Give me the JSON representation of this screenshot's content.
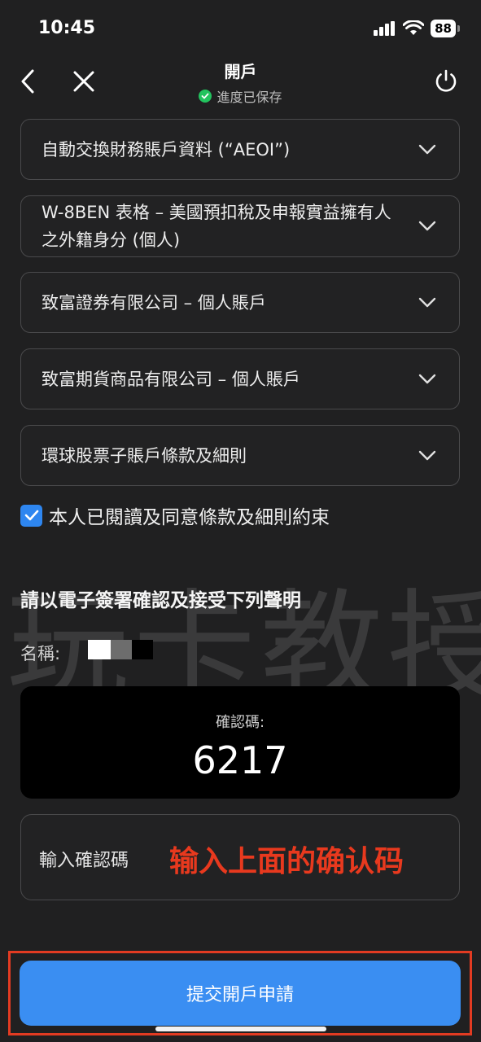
{
  "status_bar": {
    "time": "10:45",
    "battery": "88"
  },
  "nav": {
    "title": "開戶",
    "subtitle": "進度已保存"
  },
  "sections": [
    {
      "label": "自動交換財務賬戶資料 (“AEOI”)"
    },
    {
      "label": "W-8BEN 表格 – 美國預扣稅及申報實益擁有人之外籍身分 (個人)"
    },
    {
      "label": "致富證券有限公司 – 個人賬戶"
    },
    {
      "label": "致富期貨商品有限公司 – 個人賬戶"
    },
    {
      "label": "環球股票子賬戶條款及細則"
    }
  ],
  "agreement": {
    "label": "本人已閱讀及同意條款及細則約束",
    "checked": true
  },
  "watermark": "玩卡教授",
  "signature": {
    "title": "請以電子簽署確認及接受下列聲明",
    "name_label": "名稱:",
    "code_label": "確認碼:",
    "code_value": "6217",
    "input_label": "輸入確認碼",
    "annotation": "输入上面的确认码"
  },
  "submit": {
    "label": "提交開戶申請"
  },
  "colors": {
    "accent": "#3a8ef2",
    "saved_green": "#22c35e",
    "annotation_red": "#e8391e"
  }
}
